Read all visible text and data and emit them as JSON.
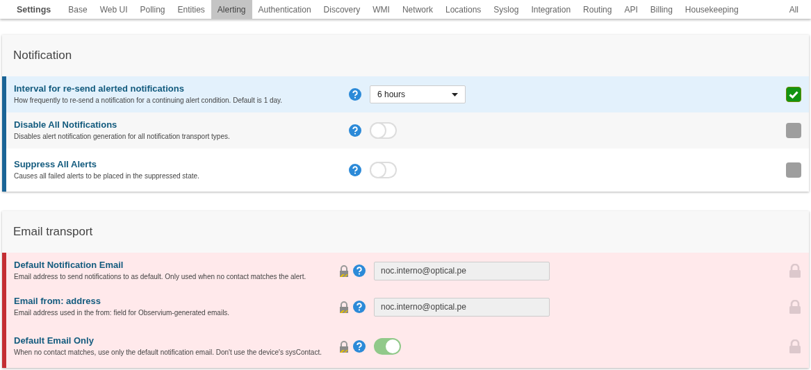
{
  "nav": {
    "brand": "Settings",
    "tabs": [
      {
        "label": "Base",
        "selected": false
      },
      {
        "label": "Web UI",
        "selected": false
      },
      {
        "label": "Polling",
        "selected": false
      },
      {
        "label": "Entities",
        "selected": false
      },
      {
        "label": "Alerting",
        "selected": true
      },
      {
        "label": "Authentication",
        "selected": false
      },
      {
        "label": "Discovery",
        "selected": false
      },
      {
        "label": "WMI",
        "selected": false
      },
      {
        "label": "Network",
        "selected": false
      },
      {
        "label": "Locations",
        "selected": false
      },
      {
        "label": "Syslog",
        "selected": false
      },
      {
        "label": "Integration",
        "selected": false
      },
      {
        "label": "Routing",
        "selected": false
      },
      {
        "label": "API",
        "selected": false
      },
      {
        "label": "Billing",
        "selected": false
      },
      {
        "label": "Housekeeping",
        "selected": false
      }
    ],
    "all": "All"
  },
  "sections": [
    {
      "title": "Notification",
      "rows": [
        {
          "title": "Interval for re-send alerted notifications",
          "description": "How frequently to re-send a notification for a continuing alert condition. Default is 1 day.",
          "locked": false,
          "changed": true,
          "kind": "select",
          "value": "6 hours",
          "checked": true
        },
        {
          "title": "Disable All Notifications",
          "description": "Disables alert notification generation for all notification transport types.",
          "locked": false,
          "changed": false,
          "kind": "toggle",
          "on": false,
          "checked": false
        },
        {
          "title": "Suppress All Alerts",
          "description": "Causes all failed alerts to be placed in the suppressed state.",
          "locked": false,
          "changed": false,
          "kind": "toggle",
          "on": false,
          "checked": false
        }
      ]
    },
    {
      "title": "Email transport",
      "rows": [
        {
          "title": "Default Notification Email",
          "description": "Email address to send notifications to as default. Only used when no contact matches the alert.",
          "locked": true,
          "kind": "input",
          "value": "noc.interno@optical.pe"
        },
        {
          "title": "Email from: address",
          "description": "Email address used in the from: field for Observium-generated emails.",
          "locked": true,
          "kind": "input",
          "value": "noc.interno@optical.pe"
        },
        {
          "title": "Default Email Only",
          "description": "When no contact matches, use only the default notification email. Don't use the device's sysContact.",
          "locked": true,
          "kind": "toggle",
          "on": true
        }
      ]
    }
  ]
}
